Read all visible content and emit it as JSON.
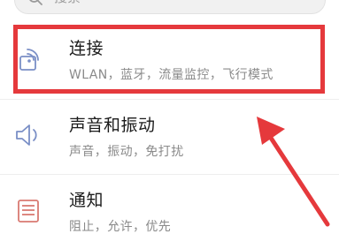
{
  "search": {
    "placeholder": "搜索"
  },
  "items": [
    {
      "title": "连接",
      "subtitle": "WLAN，蓝牙，流量监控，飞行模式",
      "icon": "wifi-connection-icon"
    },
    {
      "title": "声音和振动",
      "subtitle": "声音，振动，免打扰",
      "icon": "speaker-volume-icon"
    },
    {
      "title": "通知",
      "subtitle": "阻止，允许，优先",
      "icon": "notification-list-icon"
    }
  ],
  "colors": {
    "highlight": "#e5393c",
    "icon_blue": "#7a8fc6",
    "icon_red": "#d97a72"
  }
}
